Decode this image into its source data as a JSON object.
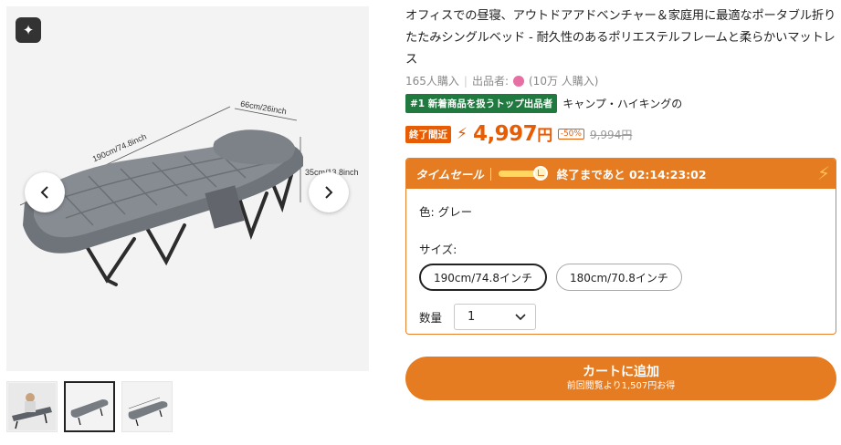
{
  "product": {
    "title": "オフィスでの昼寝、アウトドアアドベンチャー＆家庭用に最適なポータブル折りたたみシングルベッド - 耐久性のあるポリエステルフレームと柔らかいマットレス",
    "sold_count": "165人購入",
    "seller_label": "出品者:",
    "seller_sold": "(10万 人購入)",
    "rank_badge": "#1 新着商品を扱うトップ出品者",
    "rank_category": "キャンプ・ハイキングの"
  },
  "price": {
    "ending_badge": "終了間近",
    "current_value": "4,997",
    "currency": "円",
    "discount": "-50%",
    "original": "9,994円"
  },
  "sale": {
    "title": "タイムセール",
    "countdown": "終了まであと 02:14:23:02"
  },
  "options": {
    "color": "色: グレー",
    "size_label": "サイズ:",
    "sizes": [
      "190cm/74.8インチ",
      "180cm/70.8インチ"
    ],
    "selected_size": "190cm/74.8インチ",
    "qty_label": "数量",
    "qty_value": "1"
  },
  "cart": {
    "label": "カートに追加",
    "sub_label": "前回閲覧より1,507円お得"
  },
  "gallery": {
    "dim_width": "66cm/26inch",
    "dim_length": "190cm/74.8inch",
    "dim_height": "35cm/13.8inch",
    "thumbnail_count": 3,
    "active_thumbnail": 2
  },
  "colors": {
    "accent": "#e67c22",
    "price": "#e85d04",
    "rank_badge": "#207a3f"
  },
  "icons": [
    "sparkle-icon",
    "chevron-left-icon",
    "chevron-right-icon",
    "lightning-icon",
    "clock-icon",
    "chevron-down-icon"
  ]
}
